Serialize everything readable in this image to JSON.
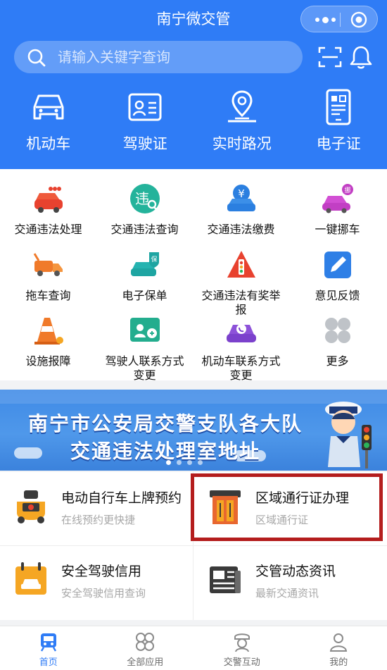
{
  "app": {
    "title": "南宁微交管"
  },
  "search": {
    "placeholder": "请输入关键字查询"
  },
  "top_nav": [
    {
      "label": "机动车",
      "icon": "car-icon"
    },
    {
      "label": "驾驶证",
      "icon": "id-card-icon"
    },
    {
      "label": "实时路况",
      "icon": "location-icon"
    },
    {
      "label": "电子证",
      "icon": "e-cert-icon"
    }
  ],
  "services": [
    {
      "label": "交通违法处理",
      "icon": "red-car-icon"
    },
    {
      "label": "交通违法查询",
      "icon": "violation-search-icon"
    },
    {
      "label": "交通违法缴费",
      "icon": "yuan-car-icon"
    },
    {
      "label": "一键挪车",
      "icon": "move-car-icon"
    },
    {
      "label": "拖车查询",
      "icon": "tow-truck-icon"
    },
    {
      "label": "电子保单",
      "icon": "insurance-icon"
    },
    {
      "label": "交通违法有奖举报",
      "line1": "交通违法有奖举",
      "line2": "报",
      "icon": "traffic-light-icon"
    },
    {
      "label": "意见反馈",
      "icon": "feedback-icon"
    },
    {
      "label": "设施报障",
      "icon": "cone-icon"
    },
    {
      "label": "驾驶人联系方式变更",
      "line1": "驾驶人联系方式",
      "line2": "变更",
      "icon": "driver-contact-icon"
    },
    {
      "label": "机动车联系方式变更",
      "line1": "机动车联系方式",
      "line2": "变更",
      "icon": "car-contact-icon"
    },
    {
      "label": "更多",
      "icon": "more-icon"
    }
  ],
  "banner": {
    "line1": "南宁市公安局交警支队各大队",
    "line2": "交通违法处理室地址"
  },
  "cards": [
    {
      "title": "电动自行车上牌预约",
      "subtitle": "在线预约更快捷",
      "icon": "ebike-icon"
    },
    {
      "title": "区域通行证办理",
      "subtitle": "区域通行证",
      "icon": "pass-icon"
    },
    {
      "title": "安全驾驶信用",
      "subtitle": "安全驾驶信用查询",
      "icon": "calendar-car-icon"
    },
    {
      "title": "交管动态资讯",
      "subtitle": "最新交通资讯",
      "icon": "news-icon"
    }
  ],
  "tabs": [
    {
      "label": "首页",
      "active": true
    },
    {
      "label": "全部应用",
      "active": false
    },
    {
      "label": "交警互动",
      "active": false
    },
    {
      "label": "我的",
      "active": false
    }
  ],
  "colors": {
    "primary": "#2f7cf6",
    "highlight": "#b41d1d"
  }
}
